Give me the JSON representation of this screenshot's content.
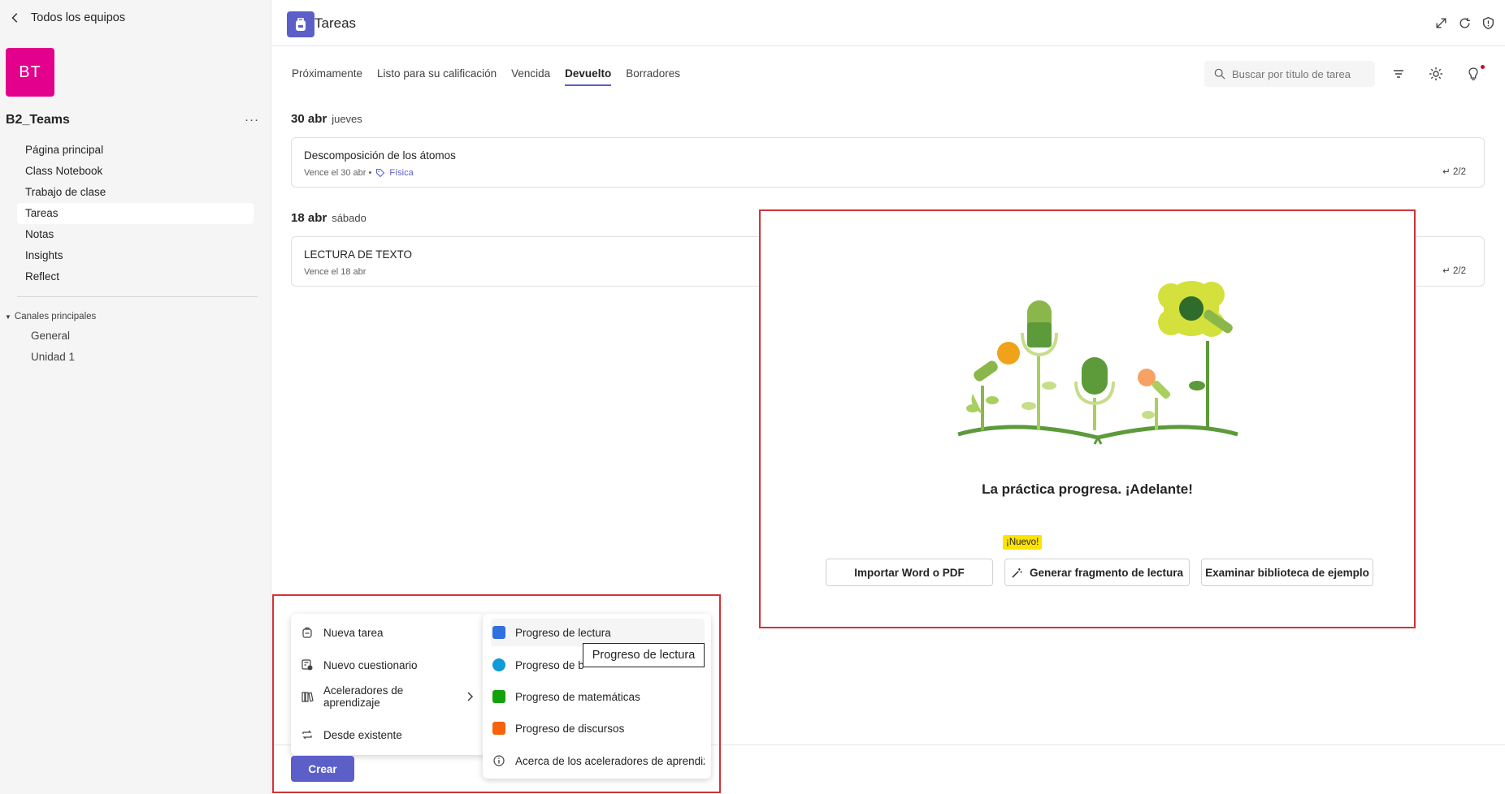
{
  "sidebar": {
    "back_label": "Todos los equipos",
    "team_initials": "BT",
    "team_name": "B2_Teams",
    "team_more": "···",
    "nav": [
      {
        "label": "Página principal"
      },
      {
        "label": "Class Notebook"
      },
      {
        "label": "Trabajo de clase"
      },
      {
        "label": "Tareas",
        "active": true
      },
      {
        "label": "Notas"
      },
      {
        "label": "Insights"
      },
      {
        "label": "Reflect"
      }
    ],
    "channels_heading": "Canales principales",
    "channels": [
      {
        "label": "General"
      },
      {
        "label": "Unidad 1"
      }
    ]
  },
  "header": {
    "title": "Tareas",
    "icons": [
      "expand-icon",
      "refresh-icon",
      "shield-icon"
    ]
  },
  "tabs": [
    {
      "label": "Próximamente"
    },
    {
      "label": "Listo para su calificación"
    },
    {
      "label": "Vencida"
    },
    {
      "label": "Devuelto",
      "active": true
    },
    {
      "label": "Borradores"
    }
  ],
  "search": {
    "placeholder": "Buscar por título de tarea"
  },
  "groups": [
    {
      "date": "30 abr",
      "weekday": "jueves",
      "assignment": {
        "title": "Descomposición de los átomos",
        "due": "Vence el 30 abr •",
        "tag": "Física",
        "count": "2/2"
      }
    },
    {
      "date": "18 abr",
      "weekday": "sábado",
      "assignment": {
        "title": "LECTURA DE TEXTO",
        "due": "Vence el 18 abr",
        "count": "2/2"
      }
    }
  ],
  "promo": {
    "headline": "La práctica progresa. ¡Adelante!",
    "new_badge": "¡Nuevo!",
    "buttons": {
      "import": "Importar Word o PDF",
      "generate": "Generar fragmento de lectura",
      "browse": "Examinar biblioteca de ejemplo"
    }
  },
  "create_menu": {
    "primary": [
      {
        "label": "Nueva tarea",
        "icon": "backpack-icon"
      },
      {
        "label": "Nuevo cuestionario",
        "icon": "quiz-icon"
      },
      {
        "label": "Aceleradores de aprendizaje",
        "icon": "books-icon"
      },
      {
        "label": "Desde existente",
        "icon": "reuse-icon"
      }
    ],
    "secondary": [
      {
        "label": "Progreso de lectura",
        "color": "#2f6fe0"
      },
      {
        "label": "Progreso de b",
        "color": "#0f9bd7"
      },
      {
        "label": "Progreso de matemáticas",
        "color": "#13a10e"
      },
      {
        "label": "Progreso de discursos",
        "color": "#f7630c"
      },
      {
        "label": "Acerca de los aceleradores de aprendiza",
        "icon": "info-icon"
      }
    ],
    "tooltip": "Progreso de lectura",
    "create_label": "Crear"
  },
  "colors": {
    "accent": "#5b5fc7",
    "team_avatar": "#e3008c",
    "highlight_frame": "#d13438",
    "badge": "#fde300"
  }
}
